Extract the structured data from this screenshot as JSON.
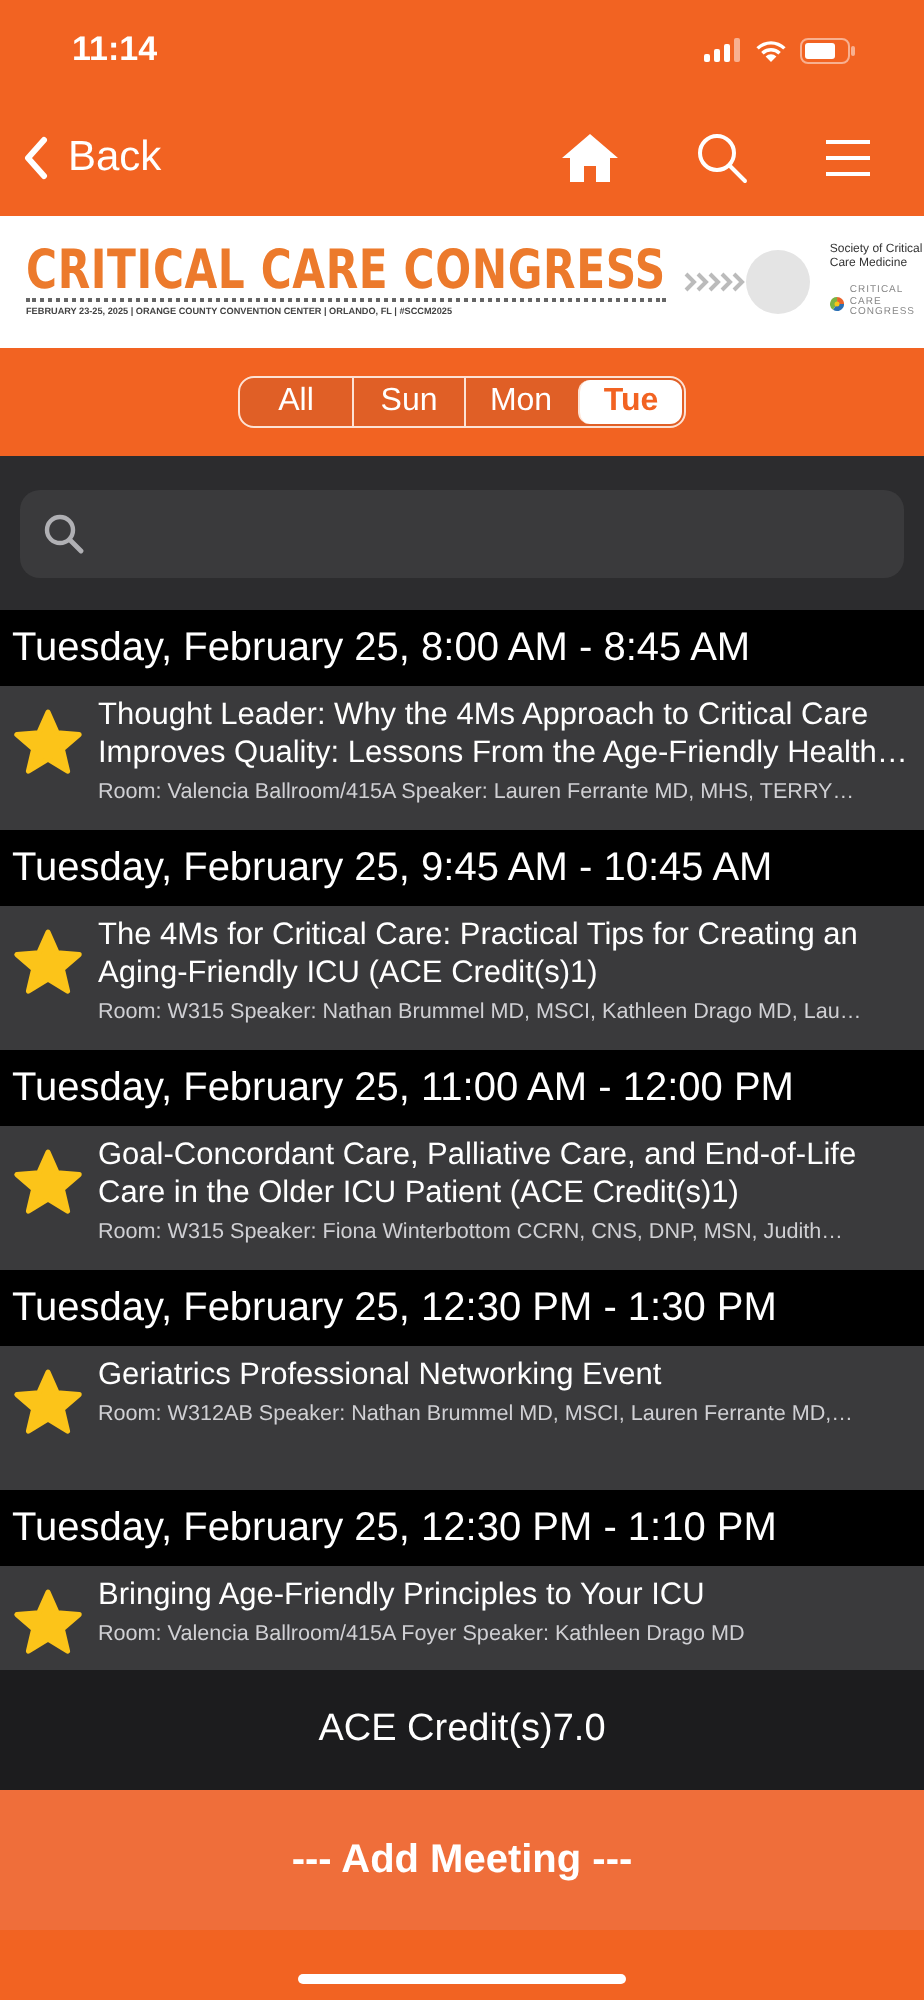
{
  "status_bar": {
    "time": "11:14"
  },
  "nav": {
    "back": "Back"
  },
  "banner": {
    "title": "CRITICAL CARE CONGRESS",
    "subtitle": "FEBRUARY 23-25, 2025 | ORANGE COUNTY CONVENTION CENTER | ORLANDO, FL | #SCCM2025",
    "society": "Society of Critical Care Medicine",
    "logo_text": "CRITICAL CARE CONGRESS"
  },
  "day_tabs": [
    {
      "label": "All",
      "selected": false
    },
    {
      "label": "Sun",
      "selected": false
    },
    {
      "label": "Mon",
      "selected": false
    },
    {
      "label": "Tue",
      "selected": true
    }
  ],
  "sections": [
    {
      "header": "Tuesday, February 25, 8:00 AM - 8:45 AM",
      "sessions": [
        {
          "title": "Thought Leader: Why the 4Ms Approach to Critical Care Improves Quality: Lessons From the Age-Friendly Health…",
          "details": "Room: Valencia Ballroom/415A Speaker: Lauren Ferrante MD, MHS, TERRY…",
          "starred": true
        }
      ]
    },
    {
      "header": "Tuesday, February 25, 9:45 AM - 10:45 AM",
      "sessions": [
        {
          "title": "The 4Ms for Critical Care: Practical Tips for Creating an Aging-Friendly ICU (ACE Credit(s)1)",
          "details": "Room: W315 Speaker: Nathan Brummel MD, MSCI, Kathleen Drago MD, Lau…",
          "starred": true
        }
      ]
    },
    {
      "header": "Tuesday, February 25, 11:00 AM - 12:00 PM",
      "sessions": [
        {
          "title": "Goal-Concordant Care, Palliative Care, and End-of-Life Care in the Older ICU Patient (ACE Credit(s)1)",
          "details": "Room: W315 Speaker: Fiona Winterbottom CCRN, CNS, DNP, MSN, Judith…",
          "starred": true
        }
      ]
    },
    {
      "header": "Tuesday, February 25, 12:30 PM - 1:30 PM",
      "sessions": [
        {
          "title": "Geriatrics Professional Networking Event",
          "details": "Room: W312AB Speaker: Nathan Brummel MD, MSCI, Lauren Ferrante MD,…",
          "starred": true
        }
      ]
    },
    {
      "header": "Tuesday, February 25, 12:30 PM - 1:10 PM",
      "sessions": [
        {
          "title": "Bringing Age-Friendly Principles to Your ICU",
          "details": "Room: Valencia Ballroom/415A Foyer Speaker: Kathleen Drago MD",
          "starred": true
        }
      ]
    }
  ],
  "footer": {
    "credits": "ACE Credit(s)7.0",
    "add_button": "--- Add Meeting ---"
  }
}
